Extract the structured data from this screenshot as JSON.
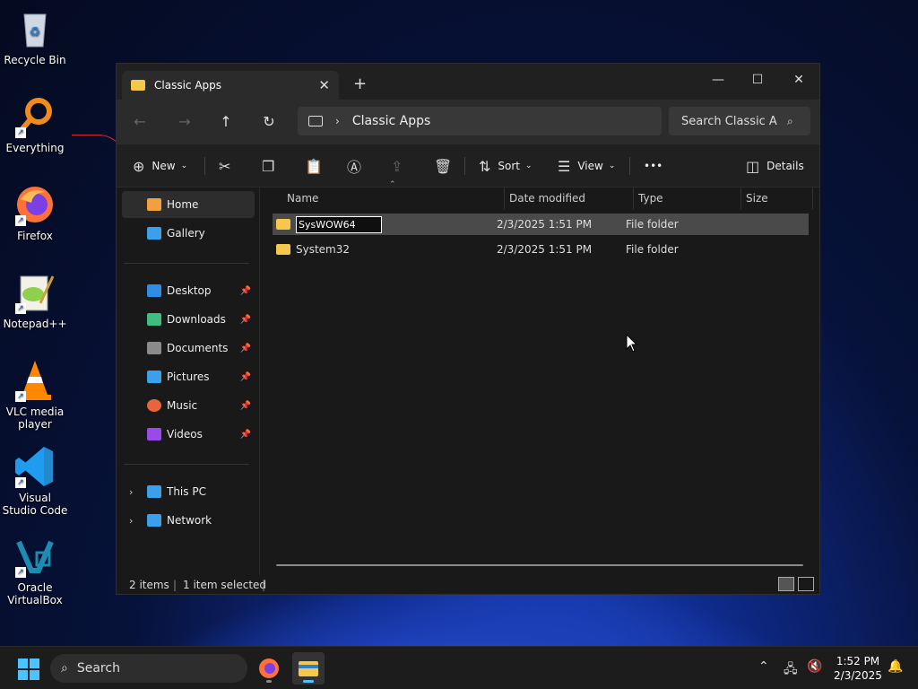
{
  "desktop": {
    "icons": [
      {
        "label": "Recycle Bin"
      },
      {
        "label": "Everything"
      },
      {
        "label": "Firefox"
      },
      {
        "label": "Notepad++"
      },
      {
        "label": "VLC media player"
      },
      {
        "label": "Visual Studio Code"
      },
      {
        "label": "Oracle VirtualBox"
      }
    ]
  },
  "window": {
    "tab_title": "Classic Apps",
    "new_tab": "+",
    "controls": {
      "minimize": "—",
      "maximize": "☐",
      "close": "✕"
    },
    "nav": {
      "back": "←",
      "forward": "→",
      "up": "↑",
      "refresh": "↻"
    },
    "address": {
      "crumb": "Classic Apps"
    },
    "search": {
      "placeholder": "Search Classic A"
    },
    "toolbar": {
      "new_label": "New",
      "sort_label": "Sort",
      "view_label": "View",
      "more_label": "•••",
      "details_label": "Details"
    },
    "sidebar": {
      "items": [
        {
          "label": "Home",
          "color": "#f0a040"
        },
        {
          "label": "Gallery",
          "color": "#3aa0e8"
        },
        {
          "label": "Desktop",
          "color": "#2f8de4"
        },
        {
          "label": "Downloads",
          "color": "#3fbf7f"
        },
        {
          "label": "Documents",
          "color": "#8a8a8a"
        },
        {
          "label": "Pictures",
          "color": "#3aa0e8"
        },
        {
          "label": "Music",
          "color": "#e8643a"
        },
        {
          "label": "Videos",
          "color": "#9a4ae8"
        },
        {
          "label": "This PC",
          "color": "#3aa0e8"
        },
        {
          "label": "Network",
          "color": "#3aa0e8"
        }
      ]
    },
    "columns": {
      "name": "Name",
      "date": "Date modified",
      "type": "Type",
      "size": "Size"
    },
    "files": [
      {
        "name": "SysWOW64",
        "date": "2/3/2025 1:51 PM",
        "type": "File folder",
        "size": ""
      },
      {
        "name": "System32",
        "date": "2/3/2025 1:51 PM",
        "type": "File folder",
        "size": ""
      }
    ],
    "status": {
      "items": "2 items",
      "selected": "1 item selected"
    }
  },
  "taskbar": {
    "search_label": "Search",
    "clock_time": "1:52 PM",
    "clock_date": "2/3/2025"
  }
}
